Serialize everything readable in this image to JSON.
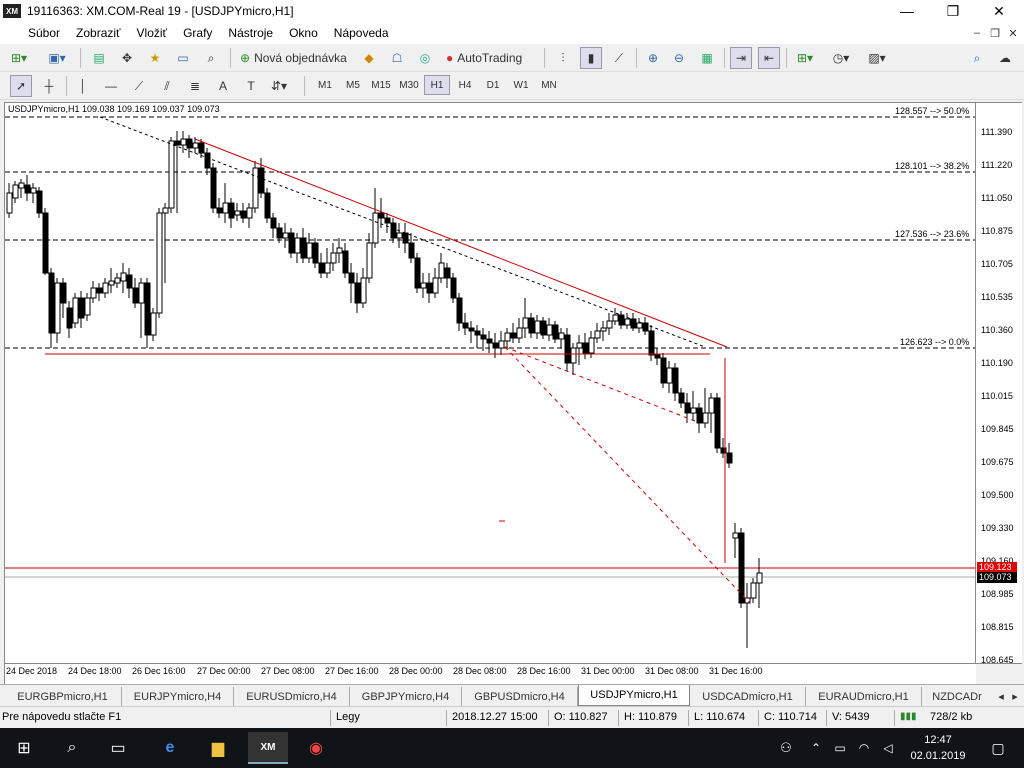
{
  "window": {
    "title": "19116363: XM.COM-Real 19 - [USDJPYmicro,H1]",
    "logo": "XM"
  },
  "menu": [
    "Súbor",
    "Zobraziť",
    "Vložiť",
    "Grafy",
    "Nástroje",
    "Okno",
    "Nápoveda"
  ],
  "toolbar": {
    "new_order": "Nová objednávka",
    "autotrading": "AutoTrading"
  },
  "timeframes": [
    "M1",
    "M5",
    "M15",
    "M30",
    "H1",
    "H4",
    "D1",
    "W1",
    "MN"
  ],
  "active_timeframe": "H1",
  "chart": {
    "header": "USDJPYmicro,H1  109.038 109.169 109.037 109.073",
    "price_labels": [
      "111.390",
      "111.220",
      "111.050",
      "110.875",
      "110.705",
      "110.535",
      "110.360",
      "110.190",
      "110.015",
      "109.845",
      "109.675",
      "109.500",
      "109.330",
      "109.160",
      "108.985",
      "108.815",
      "108.645"
    ],
    "current_red": "109.123",
    "current_black": "109.073",
    "time_labels": [
      "24 Dec 2018",
      "24 Dec 18:00",
      "26 Dec 16:00",
      "27 Dec 00:00",
      "27 Dec 08:00",
      "27 Dec 16:00",
      "28 Dec 00:00",
      "28 Dec 08:00",
      "28 Dec 16:00",
      "31 Dec 00:00",
      "31 Dec 08:00",
      "31 Dec 16:00"
    ],
    "fibo_levels": [
      {
        "label": "128.557 --> 50.0%"
      },
      {
        "label": "128.101 --> 38.2%"
      },
      {
        "label": "127.536 --> 23.6%"
      },
      {
        "label": "126.623 --> 0.0%"
      }
    ]
  },
  "tabs": [
    "EURGBPmicro,H1",
    "EURJPYmicro,H4",
    "EURUSDmicro,H4",
    "GBPJPYmicro,H4",
    "GBPUSDmicro,H4",
    "USDJPYmicro,H1",
    "USDCADmicro,H1",
    "EURAUDmicro,H1",
    "NZDCADr"
  ],
  "active_tab": "USDJPYmicro,H1",
  "status": {
    "help": "Pre nápovedu stlačte F1",
    "profile": "Legy",
    "datetime": "2018.12.27 15:00",
    "open": "O: 110.827",
    "high": "H: 110.879",
    "low": "L: 110.674",
    "close": "C: 110.714",
    "volume": "V: 5439",
    "traffic": "728/2 kb"
  },
  "taskbar": {
    "time": "12:47",
    "date": "02.01.2019"
  },
  "colors": {
    "trendline": "#cc0000",
    "price_red_box": "#e00000",
    "price_black_box": "#000000"
  }
}
